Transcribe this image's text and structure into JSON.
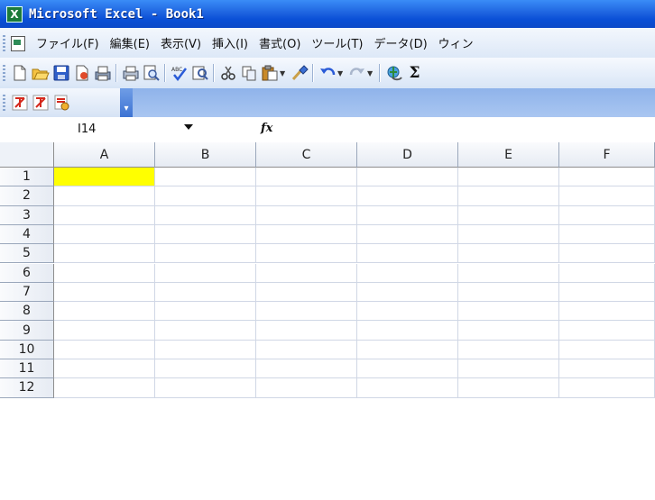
{
  "window": {
    "title": "Microsoft Excel - Book1",
    "icon": "excel-icon"
  },
  "menu": {
    "items": [
      "ファイル(F)",
      "編集(E)",
      "表示(V)",
      "挿入(I)",
      "書式(O)",
      "ツール(T)",
      "データ(D)",
      "ウィン"
    ]
  },
  "toolbar": {
    "icons": [
      "new-icon",
      "open-icon",
      "save-icon",
      "permission-icon",
      "print-preview-icon",
      "print-icon",
      "preview-icon",
      "spelling-icon",
      "research-icon",
      "cut-icon",
      "copy-icon",
      "paste-icon",
      "format-painter-icon",
      "undo-icon",
      "redo-icon",
      "hyperlink-icon",
      "autosum-icon"
    ],
    "autosum_label": "Σ"
  },
  "pdf_toolbar": {
    "icons": [
      "pdf-create-icon",
      "pdf-email-icon",
      "pdf-review-icon"
    ],
    "overflow_label": "▾"
  },
  "formula_bar": {
    "name_box": "I14",
    "fx_label": "fx",
    "formula": ""
  },
  "sheet": {
    "columns": [
      "A",
      "B",
      "C",
      "D",
      "E",
      "F"
    ],
    "rows": [
      "1",
      "2",
      "3",
      "4",
      "5",
      "6",
      "7",
      "8",
      "9",
      "10",
      "11",
      "12"
    ],
    "highlight_cell": "A1",
    "highlight_color": "#ffff00"
  }
}
